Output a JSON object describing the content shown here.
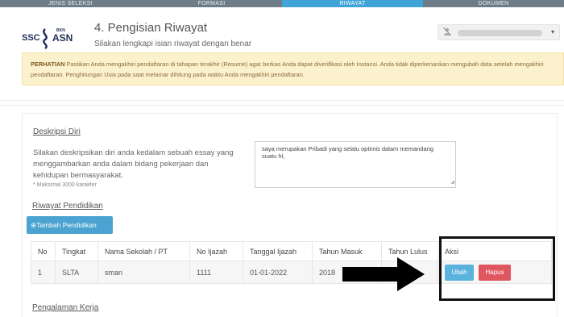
{
  "nav": {
    "tabs": [
      {
        "label": "JENIS SELEKSI"
      },
      {
        "label": "FORMASI"
      },
      {
        "label": "RIWAYAT"
      },
      {
        "label": "DOKUMEN"
      }
    ]
  },
  "header": {
    "logo_ssc": "SSC",
    "logo_bkn": "BKN",
    "logo_asn": "ASN",
    "title": "4. Pengisian Riwayat",
    "subtitle": "Silakan lengkapi isian riwayat dengan benar"
  },
  "user_menu": {
    "icon": "user-icon",
    "caret": "▾"
  },
  "alert": {
    "label": "PERHATIAN",
    "text": " Pastikan Anda mengakhiri pendaftaran di tahapan terakhir (Resume) agar berkas Anda dapat diverifikasi oleh Instansi. Anda tidak diperkenankan mengubah data setelah mengakhiri pendaftaran. Penghitungan Usia pada saat melamar dihitung pada waktu Anda mengakhiri pendaftaran."
  },
  "deskripsi": {
    "title": "Deskripsi Diri",
    "instruction": "Silakan deskripsikan diri anda kedalam sebuah essay yang menggambarkan anda dalam bidang pekerjaan dan kehidupan bermasyarakat.",
    "note": "* Maksimal 3000 karakter",
    "essay_value": "saya merupakan Pribadi yang selalu optimis dalam memandang suatu hl,"
  },
  "pendidikan": {
    "title": "Riwayat Pendidikan",
    "add_button": "Tambah Pendidikan",
    "columns": [
      "No",
      "Tingkat",
      "Nama Sekolah / PT",
      "No Ijazah",
      "Tanggal Ijazah",
      "Tahun Masuk",
      "Tahun Lulus",
      "Aksi"
    ],
    "rows": [
      {
        "no": "1",
        "tingkat": "SLTA",
        "nama": "sman",
        "no_ijazah": "1111",
        "tanggal": "01-01-2022",
        "tahun_masuk": "2018",
        "tahun_lulus": ""
      }
    ],
    "edit_label": "Ubah",
    "delete_label": "Hapus"
  },
  "pengalaman": {
    "title": "Pengalaman Kerja"
  },
  "colors": {
    "nav_bg": "#6d7c87",
    "nav_active": "#3fa4d8",
    "alert_bg": "#fcf1cd",
    "edit_btn": "#5ab3dd",
    "delete_btn": "#e0565f",
    "add_btn": "#4aa3d1"
  }
}
